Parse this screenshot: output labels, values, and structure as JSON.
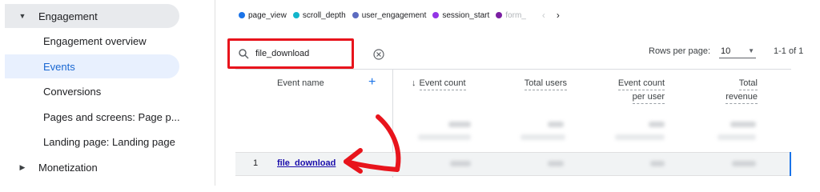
{
  "sidebar": {
    "items": [
      {
        "label": "Engagement",
        "type": "section",
        "expanded": true
      },
      {
        "label": "Engagement overview",
        "type": "sub"
      },
      {
        "label": "Events",
        "type": "sub",
        "active": true
      },
      {
        "label": "Conversions",
        "type": "sub"
      },
      {
        "label": "Pages and screens: Page p...",
        "type": "sub"
      },
      {
        "label": "Landing page: Landing page",
        "type": "sub"
      },
      {
        "label": "Monetization",
        "type": "section",
        "expanded": false
      }
    ]
  },
  "legend": {
    "items": [
      {
        "label": "page_view",
        "color": "#1a73e8"
      },
      {
        "label": "scroll_depth",
        "color": "#12b5cb"
      },
      {
        "label": "user_engagement",
        "color": "#5c6bc0"
      },
      {
        "label": "session_start",
        "color": "#9334e6"
      },
      {
        "label": "form_",
        "color": "#7b1fa2"
      }
    ],
    "prev": "‹",
    "next": "›"
  },
  "toolbar": {
    "search_value": "file_download",
    "rows_per_page_label": "Rows per page:",
    "rows_per_page_value": "10",
    "range_text": "1-1 of 1"
  },
  "table": {
    "columns": {
      "event_name": "Event name",
      "event_count": "Event count",
      "total_users": "Total users",
      "event_count_per_user_1": "Event count",
      "event_count_per_user_2": "per user",
      "total_revenue_1": "Total",
      "total_revenue_2": "revenue"
    },
    "rows": [
      {
        "index": "1",
        "event_name": "file_download"
      }
    ]
  },
  "colors": {
    "accent": "#1a73e8",
    "highlight_red": "#e8141c",
    "active_bg": "#e8f0fe"
  }
}
